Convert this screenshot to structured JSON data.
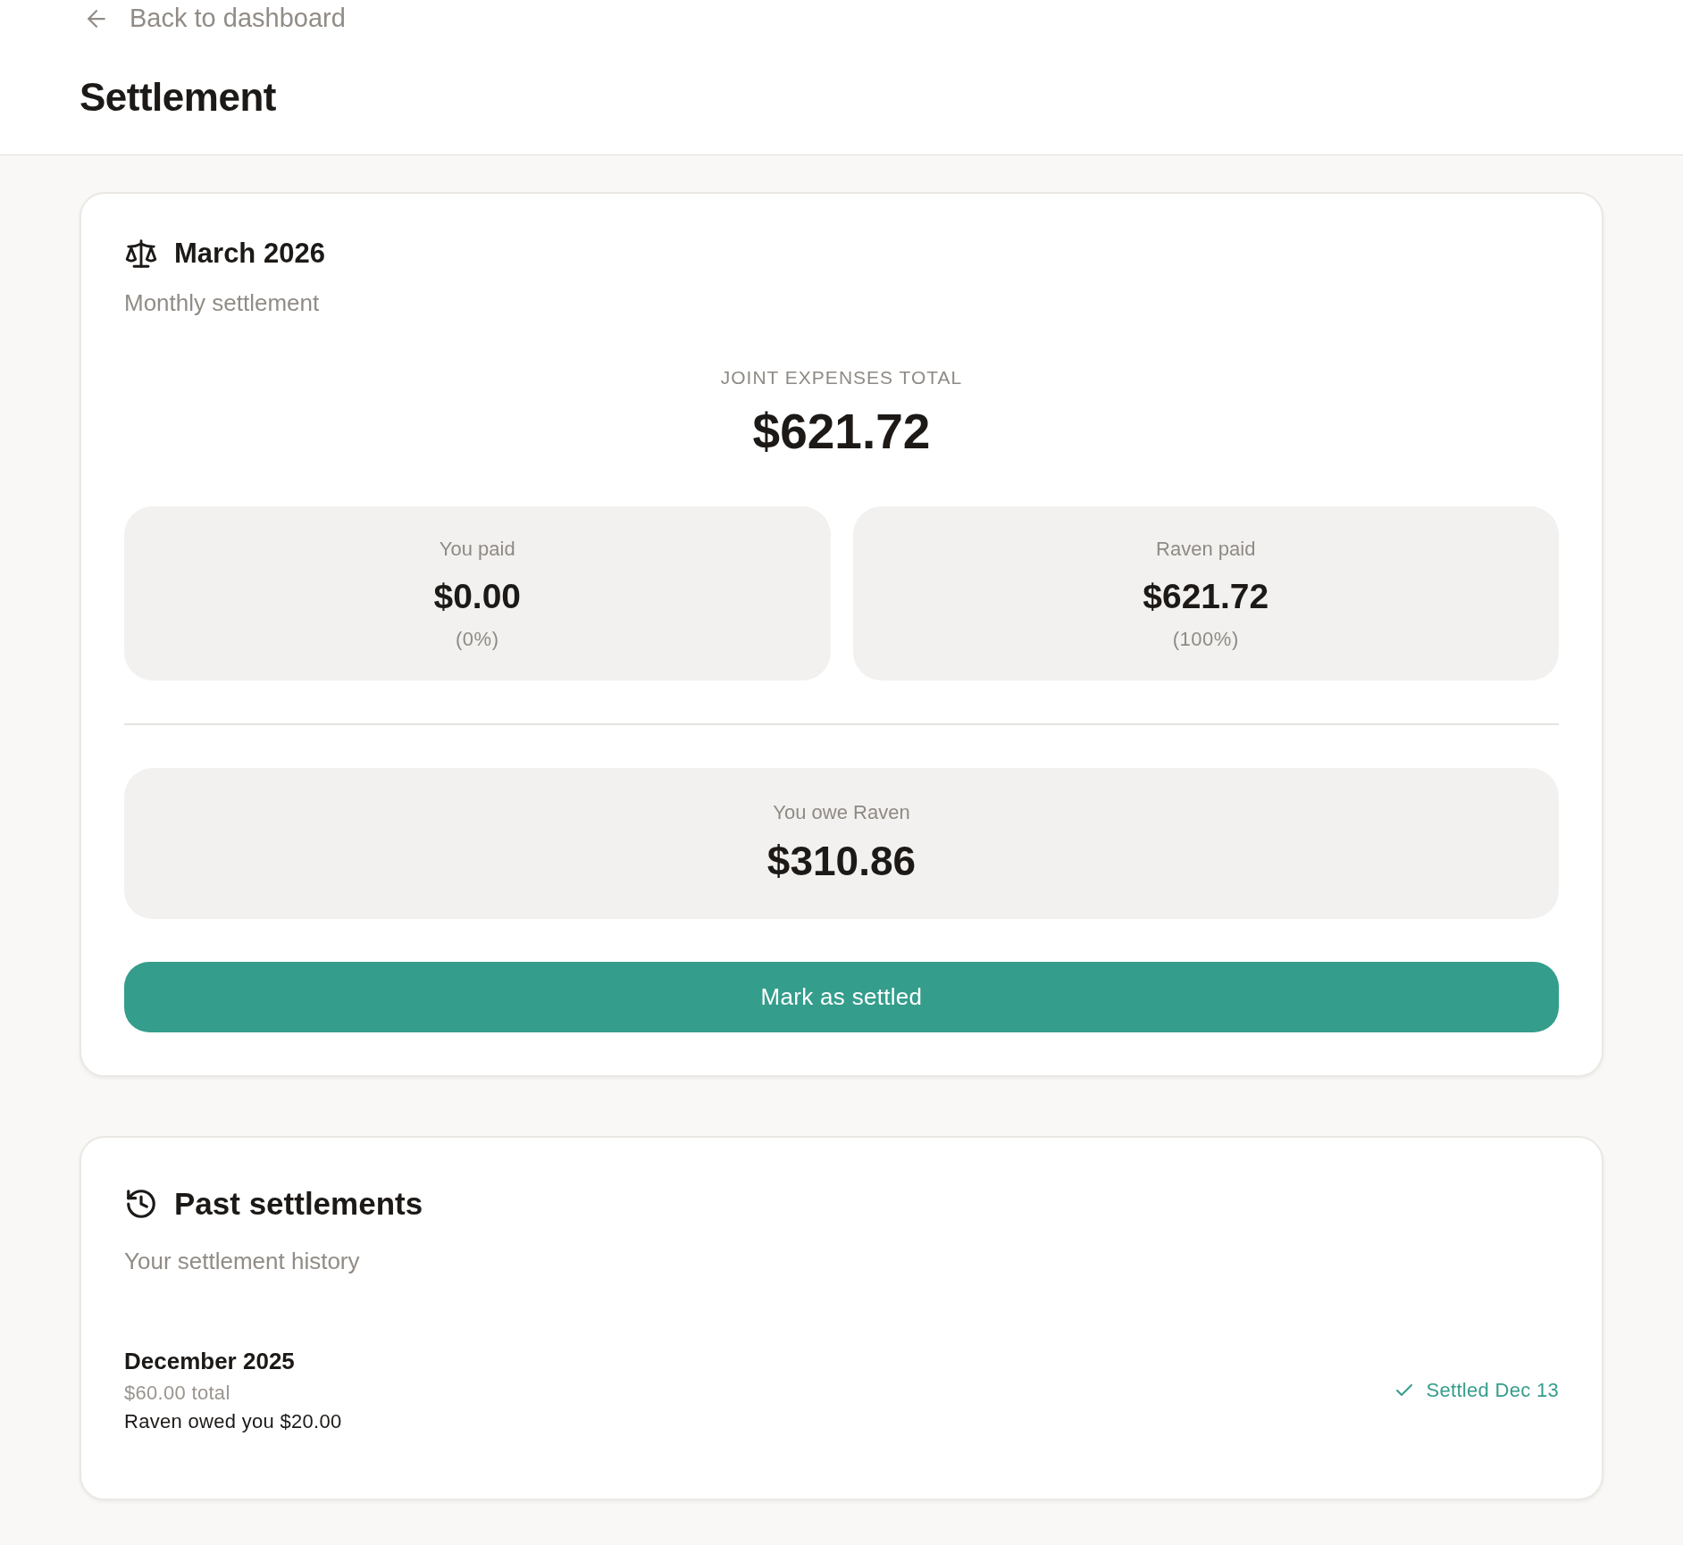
{
  "header": {
    "back_link": {
      "label": "Back to dashboard"
    },
    "title": "Settlement"
  },
  "current_settlement": {
    "title": "March 2026",
    "subtitle": "Monthly settlement",
    "total_label": "JOINT EXPENSES TOTAL",
    "total": "$621.72",
    "payers": [
      {
        "label": "You paid",
        "amount": "$0.00",
        "share": "(0%)"
      },
      {
        "label": "Raven paid",
        "amount": "$621.72",
        "share": "(100%)"
      }
    ],
    "balance": {
      "label": "You owe Raven",
      "amount": "$310.86"
    },
    "action": {
      "label": "Mark as settled"
    }
  },
  "past_settlements": {
    "title": "Past settlements",
    "subtitle": "Your settlement history",
    "items": [
      {
        "period": "December 2025",
        "total": "$60.00 total",
        "detail": "Raven owed you $20.00",
        "status": "Settled Dec 13",
        "settled": true
      }
    ]
  }
}
